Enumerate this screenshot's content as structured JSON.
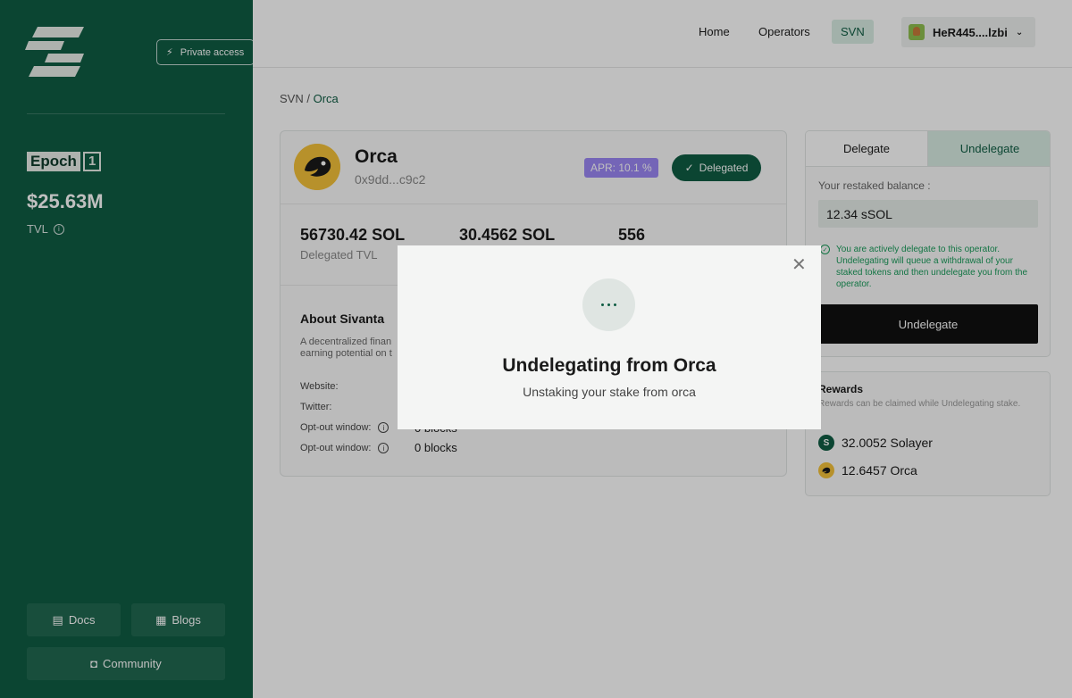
{
  "sidebar": {
    "private_access_label": "Private access",
    "epoch_label": "Epoch",
    "epoch_number": "1",
    "tvl_value": "$25.63M",
    "tvl_label": "TVL",
    "docs_label": "Docs",
    "blogs_label": "Blogs",
    "community_label": "Community"
  },
  "header": {
    "nav": {
      "home": "Home",
      "operators": "Operators",
      "svn": "SVN"
    },
    "wallet_address": "HeR445....lzbi"
  },
  "breadcrumb": {
    "root": "SVN /",
    "current": "Orca"
  },
  "operator": {
    "name": "Orca",
    "address": "0x9dd...c9c2",
    "apr_label": "APR: 10.1 %",
    "delegated_label": "Delegated",
    "stats": [
      {
        "value": "56730.42 SOL",
        "label": "Delegated TVL"
      },
      {
        "value": "30.4562 SOL",
        "label": ""
      },
      {
        "value": "556",
        "label": ""
      }
    ],
    "about_title": "About Sivanta",
    "about_desc_line1": "A decentralized finan",
    "about_desc_line2": "earning potential on t",
    "website_label": "Website:",
    "twitter_label": "Twitter:",
    "optout1_label": "Opt-out window:",
    "optout1_value": "0 blocks",
    "optout2_label": "Opt-out window:",
    "optout2_value": "0 blocks"
  },
  "stake_panel": {
    "tab_delegate": "Delegate",
    "tab_undelegate": "Undelegate",
    "balance_label": "Your restaked balance :",
    "balance_value": "12.34 sSOL",
    "notice": "You are actively delegate to this operator. Undelegating will queue a withdrawal of your staked tokens and then undelegate you from the operator.",
    "button_label": "Undelegate"
  },
  "rewards": {
    "title": "Rewards",
    "desc": "Rewards can be claimed while Undelegating stake.",
    "items": [
      {
        "amount": "32.0052 Solayer",
        "icon": "solayer-icon"
      },
      {
        "amount": "12.6457 Orca",
        "icon": "orca-icon"
      }
    ]
  },
  "modal": {
    "title": "Undelegating from Orca",
    "subtitle": "Unstaking your stake from orca"
  },
  "colors": {
    "brand_green": "#0f5c43",
    "apr_purple": "#9b87f5",
    "success_green": "#1a9c5b"
  }
}
